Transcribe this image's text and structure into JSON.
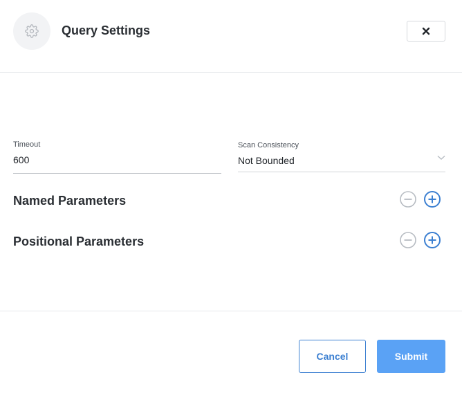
{
  "dialog": {
    "title": "Query Settings",
    "header_icon": "gear-icon",
    "close_icon": "close-icon"
  },
  "form": {
    "timeout": {
      "label": "Timeout",
      "value": "600"
    },
    "scan_consistency": {
      "label": "Scan Consistency",
      "value": "Not Bounded",
      "icon": "chevron-down-icon"
    }
  },
  "sections": {
    "named": {
      "title": "Named Parameters",
      "remove_icon": "minus-circle-icon",
      "add_icon": "plus-circle-icon"
    },
    "positional": {
      "title": "Positional Parameters",
      "remove_icon": "minus-circle-icon",
      "add_icon": "plus-circle-icon"
    }
  },
  "footer": {
    "cancel_label": "Cancel",
    "submit_label": "Submit"
  },
  "colors": {
    "accent": "#3b7fd1",
    "submit_bg": "#5aa2f5",
    "disabled": "#b7bcc2"
  }
}
